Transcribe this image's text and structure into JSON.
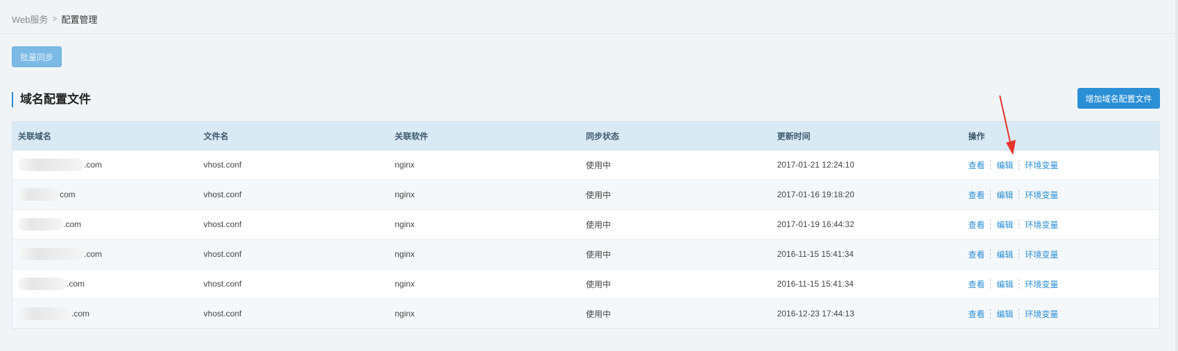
{
  "breadcrumb": {
    "parent": "Web服务",
    "separator": ">",
    "current": "配置管理"
  },
  "toolbar": {
    "batch_sync_label": "批量同步"
  },
  "section": {
    "title": "域名配置文件",
    "add_button_label": "增加域名配置文件"
  },
  "table": {
    "headers": [
      "关联域名",
      "文件名",
      "关联软件",
      "同步状态",
      "更新时间",
      "操作"
    ],
    "rows": [
      {
        "domain_suffix": ".com",
        "file": "vhost.conf",
        "software": "nginx",
        "status": "使用中",
        "updated": "2017-01-21 12:24:10"
      },
      {
        "domain_suffix": "com",
        "file": "vhost.conf",
        "software": "nginx",
        "status": "使用中",
        "updated": "2017-01-16 19:18:20"
      },
      {
        "domain_suffix": ".com",
        "file": "vhost.conf",
        "software": "nginx",
        "status": "使用中",
        "updated": "2017-01-19 16:44:32"
      },
      {
        "domain_suffix": ".com",
        "file": "vhost.conf",
        "software": "nginx",
        "status": "使用中",
        "updated": "2016-11-15 15:41:34"
      },
      {
        "domain_suffix": ".com",
        "file": "vhost.conf",
        "software": "nginx",
        "status": "使用中",
        "updated": "2016-11-15 15:41:34"
      },
      {
        "domain_suffix": ".com",
        "file": "vhost.conf",
        "software": "nginx",
        "status": "使用中",
        "updated": "2016-12-23 17:44:13"
      }
    ],
    "actions": {
      "view": "查看",
      "edit": "编辑",
      "env": "环境变量"
    }
  },
  "colors": {
    "accent": "#2b8fd6",
    "header_bg": "#d9eaf5",
    "annotation_arrow": "#e8332a"
  }
}
